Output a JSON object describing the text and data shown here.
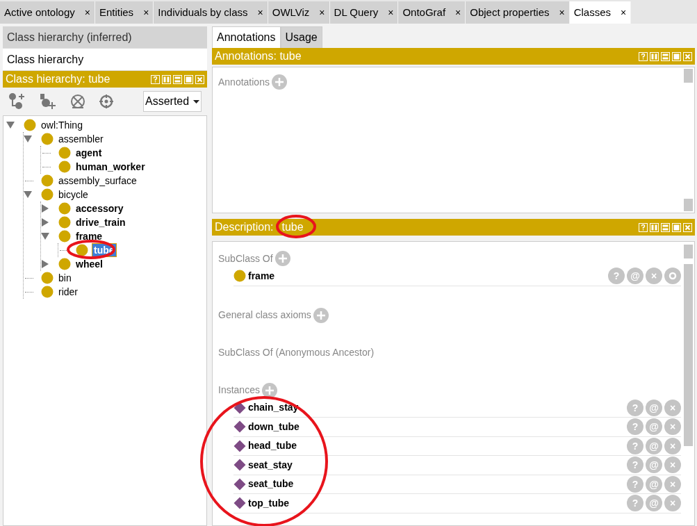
{
  "tabs": [
    {
      "label": "Active ontology",
      "close": "×",
      "selected": false
    },
    {
      "label": "Entities",
      "close": "×",
      "selected": false
    },
    {
      "label": "Individuals by class",
      "close": "×",
      "selected": false
    },
    {
      "label": "OWLViz",
      "close": "×",
      "selected": false
    },
    {
      "label": "DL Query",
      "close": "×",
      "selected": false
    },
    {
      "label": "OntoGraf",
      "close": "×",
      "selected": false
    },
    {
      "label": "Object properties",
      "close": "×",
      "selected": false
    },
    {
      "label": "Classes",
      "close": "×",
      "selected": true
    }
  ],
  "left": {
    "view_tabs": [
      {
        "label": "Class hierarchy (inferred)",
        "selected": false
      },
      {
        "label": "Class hierarchy",
        "selected": true
      }
    ],
    "header": "Class hierarchy: tube",
    "mode": "Asserted",
    "tree": [
      {
        "label": "owl:Thing",
        "bold": false,
        "selected": false,
        "expanded": true,
        "children": [
          {
            "label": "assembler",
            "bold": false,
            "selected": false,
            "expanded": true,
            "children": [
              {
                "label": "agent",
                "bold": true,
                "selected": false
              },
              {
                "label": "human_worker",
                "bold": true,
                "selected": false
              }
            ]
          },
          {
            "label": "assembly_surface",
            "bold": false,
            "selected": false
          },
          {
            "label": "bicycle",
            "bold": false,
            "selected": false,
            "expanded": true,
            "children": [
              {
                "label": "accessory",
                "bold": true,
                "selected": false,
                "expanded": false
              },
              {
                "label": "drive_train",
                "bold": true,
                "selected": false,
                "expanded": false
              },
              {
                "label": "frame",
                "bold": true,
                "selected": false,
                "expanded": true,
                "children": [
                  {
                    "label": "tube",
                    "bold": true,
                    "selected": true
                  }
                ]
              },
              {
                "label": "wheel",
                "bold": true,
                "selected": false,
                "expanded": false
              }
            ]
          },
          {
            "label": "bin",
            "bold": false,
            "selected": false
          },
          {
            "label": "rider",
            "bold": false,
            "selected": false
          }
        ]
      }
    ]
  },
  "right": {
    "tabs": [
      {
        "label": "Annotations",
        "selected": true
      },
      {
        "label": "Usage",
        "selected": false
      }
    ],
    "annotations_header": "Annotations: tube",
    "annotations_label": "Annotations",
    "description_header": {
      "label": "Description:",
      "subject": "tube"
    },
    "sections": [
      {
        "title": "SubClass Of",
        "add": true,
        "items": [
          {
            "label": "frame",
            "kind": "class",
            "buttons": [
              "?",
              "@",
              "×"
            ],
            "edit": true
          }
        ]
      },
      {
        "title": "General class axioms",
        "add": true
      },
      {
        "title": "SubClass Of (Anonymous Ancestor)",
        "add": false
      },
      {
        "title": "Instances",
        "add": true,
        "items": [
          {
            "label": "chain_stay",
            "kind": "individual",
            "buttons": [
              "?",
              "@",
              "×"
            ],
            "edit": false
          },
          {
            "label": "down_tube",
            "kind": "individual",
            "buttons": [
              "?",
              "@",
              "×"
            ],
            "edit": false
          },
          {
            "label": "head_tube",
            "kind": "individual",
            "buttons": [
              "?",
              "@",
              "×"
            ],
            "edit": false
          },
          {
            "label": "seat_stay",
            "kind": "individual",
            "buttons": [
              "?",
              "@",
              "×"
            ],
            "edit": false
          },
          {
            "label": "seat_tube",
            "kind": "individual",
            "buttons": [
              "?",
              "@",
              "×"
            ],
            "edit": false
          },
          {
            "label": "top_tube",
            "kind": "individual",
            "buttons": [
              "?",
              "@",
              "×"
            ],
            "edit": false
          }
        ]
      }
    ]
  }
}
